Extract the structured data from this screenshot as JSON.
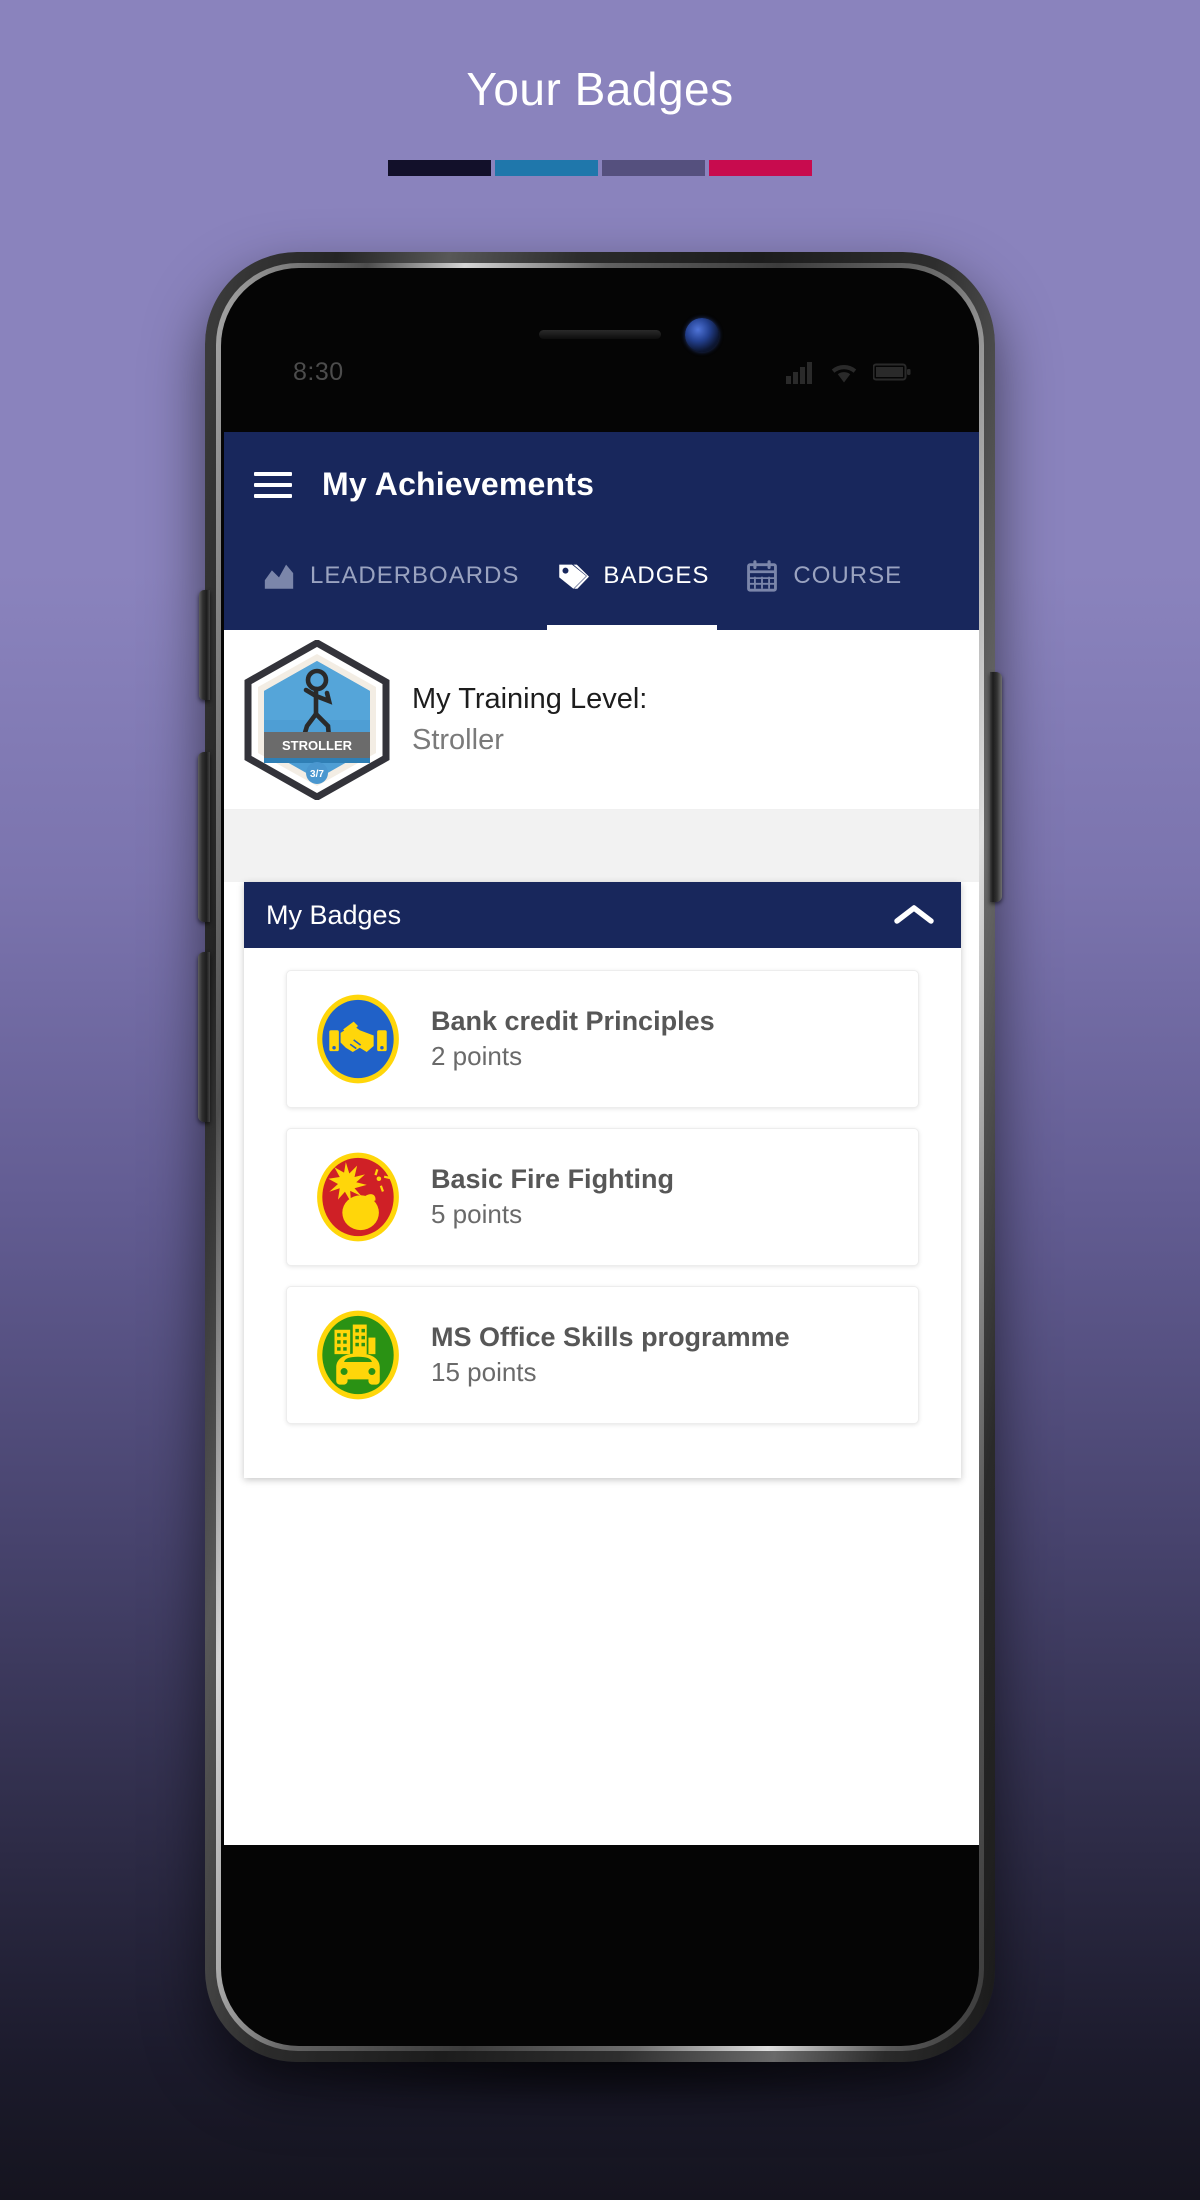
{
  "page": {
    "heading": "Your Badges",
    "accent_bar": [
      {
        "name": "segment-navy",
        "color": "#12102a"
      },
      {
        "name": "segment-blue",
        "color": "#1f77ab"
      },
      {
        "name": "segment-purple",
        "color": "#55507e"
      },
      {
        "name": "segment-crimson",
        "color": "#c80b4e"
      }
    ],
    "background_top_color": "#8a83bd",
    "background_bottom_color": "#15141f"
  },
  "device": {
    "status_bar": {
      "time": "8:30",
      "icons": [
        "signal-icon",
        "wifi-icon",
        "battery-icon"
      ]
    }
  },
  "app": {
    "brand_color": "#18275c",
    "appbar": {
      "menu_icon": "hamburger-menu-icon",
      "title": "My Achievements"
    },
    "tabs": [
      {
        "label": "LEADERBOARDS",
        "icon": "chart-icon",
        "active": false
      },
      {
        "label": "BADGES",
        "icon": "tag-icon",
        "active": true
      },
      {
        "label": "COURSE",
        "icon": "calendar-icon",
        "active": false
      }
    ],
    "training_level": {
      "title": "My Training Level:",
      "value": "Stroller",
      "badge": {
        "name": "hexagon-level-badge",
        "label": "STROLLER",
        "progress": "3/7",
        "fill_color": "#4e9ed4",
        "band_color": "#6b6b6b",
        "outline_color": "#2f2f35"
      }
    },
    "badges_panel": {
      "title": "My Badges",
      "toggle_icon": "chevron-up-icon",
      "expanded": true,
      "items": [
        {
          "name": "Bank credit Principles",
          "points": "2 points",
          "icon": "handshake-icon",
          "circle_color": "#2061c8",
          "ring_color": "#ffd60a",
          "glyph_color": "#ffd60a"
        },
        {
          "name": "Basic Fire Fighting",
          "points": "5 points",
          "icon": "bomb-icon",
          "circle_color": "#cf2026",
          "ring_color": "#ffd60a",
          "glyph_color": "#ffd60a"
        },
        {
          "name": "MS Office Skills programme",
          "points": "15 points",
          "icon": "city-car-icon",
          "circle_color": "#2a9214",
          "ring_color": "#ffd60a",
          "glyph_color": "#ffd60a"
        }
      ]
    }
  }
}
